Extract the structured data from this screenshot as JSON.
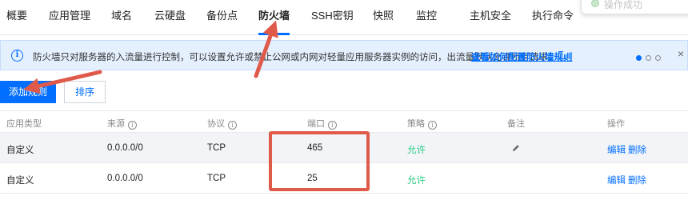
{
  "tabs": [
    {
      "label": "概要",
      "active": false
    },
    {
      "label": "应用管理",
      "active": false
    },
    {
      "label": "域名",
      "active": false
    },
    {
      "label": "云硬盘",
      "active": false
    },
    {
      "label": "备份点",
      "active": false
    },
    {
      "label": "防火墙",
      "active": true
    },
    {
      "label": "SSH密钥",
      "active": false
    },
    {
      "label": "快照",
      "active": false
    },
    {
      "label": "监控",
      "active": false
    },
    {
      "label": "主机安全",
      "active": false
    },
    {
      "label": "执行命令",
      "active": false
    }
  ],
  "toast": {
    "text": "操作成功"
  },
  "notice": {
    "message": "防火墙只对服务器的入流量进行控制，可以设置允许或禁止公网或内网对轻量应用服务器实例的访问，出流量默认允许所有请求。",
    "link": "查看如何配置防火墙规则",
    "info_icon": "i",
    "close": "×"
  },
  "buttons": {
    "add_rule": "添加规则",
    "sort": "排序"
  },
  "table": {
    "headers": {
      "app_type": "应用类型",
      "source": "来源",
      "protocol": "协议",
      "port": "端口",
      "policy": "策略",
      "remark": "备注",
      "actions": "操作"
    },
    "rows": [
      {
        "app_type": "自定义",
        "source": "0.0.0.0/0",
        "protocol": "TCP",
        "port": "465",
        "policy": "允许",
        "edit": "编辑",
        "delete": "删除"
      },
      {
        "app_type": "自定义",
        "source": "0.0.0.0/0",
        "protocol": "TCP",
        "port": "25",
        "policy": "允许",
        "edit": "编辑",
        "delete": "删除"
      }
    ]
  },
  "colors": {
    "accent": "#006eff",
    "allow": "#29cc85",
    "annotation": "#e05a4a",
    "notice_bg": "#e5f0ff"
  }
}
